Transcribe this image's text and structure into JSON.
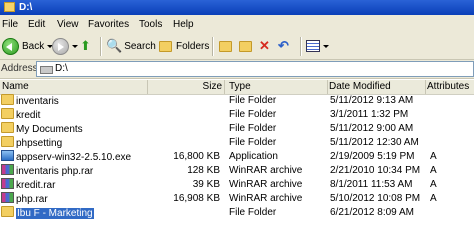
{
  "window": {
    "title": "D:\\"
  },
  "menu": [
    "File",
    "Edit",
    "View",
    "Favorites",
    "Tools",
    "Help"
  ],
  "toolbar": {
    "back_label": "Back",
    "search_label": "Search",
    "folders_label": "Folders"
  },
  "address": {
    "label": "Address",
    "value": "D:\\"
  },
  "columns": [
    "Name",
    "Size",
    "Type",
    "Date Modified",
    "Attributes"
  ],
  "files": [
    {
      "name": "inventaris",
      "size": "",
      "type": "File Folder",
      "date": "5/11/2012 9:13 AM",
      "attr": "",
      "icon": "folder-icon"
    },
    {
      "name": "kredit",
      "size": "",
      "type": "File Folder",
      "date": "3/1/2011 1:32 PM",
      "attr": "",
      "icon": "folder-icon"
    },
    {
      "name": "My Documents",
      "size": "",
      "type": "File Folder",
      "date": "5/11/2012 9:00 AM",
      "attr": "",
      "icon": "folder-icon"
    },
    {
      "name": "phpsetting",
      "size": "",
      "type": "File Folder",
      "date": "5/11/2012 12:30 AM",
      "attr": "",
      "icon": "folder-icon"
    },
    {
      "name": "appserv-win32-2.5.10.exe",
      "size": "16,800 KB",
      "type": "Application",
      "date": "2/19/2009 5:19 PM",
      "attr": "A",
      "icon": "application-icon"
    },
    {
      "name": "inventaris php.rar",
      "size": "128 KB",
      "type": "WinRAR archive",
      "date": "2/21/2010 10:34 PM",
      "attr": "A",
      "icon": "rar-icon"
    },
    {
      "name": "kredit.rar",
      "size": "39 KB",
      "type": "WinRAR archive",
      "date": "8/1/2011 11:53 AM",
      "attr": "A",
      "icon": "rar-icon"
    },
    {
      "name": "php.rar",
      "size": "16,908 KB",
      "type": "WinRAR archive",
      "date": "5/10/2012 10:08 PM",
      "attr": "A",
      "icon": "rar-icon"
    },
    {
      "name": "Ibu F - Marketing",
      "size": "",
      "type": "File Folder",
      "date": "6/21/2012 8:09 AM",
      "attr": "",
      "icon": "folder-icon",
      "selected": true
    }
  ]
}
